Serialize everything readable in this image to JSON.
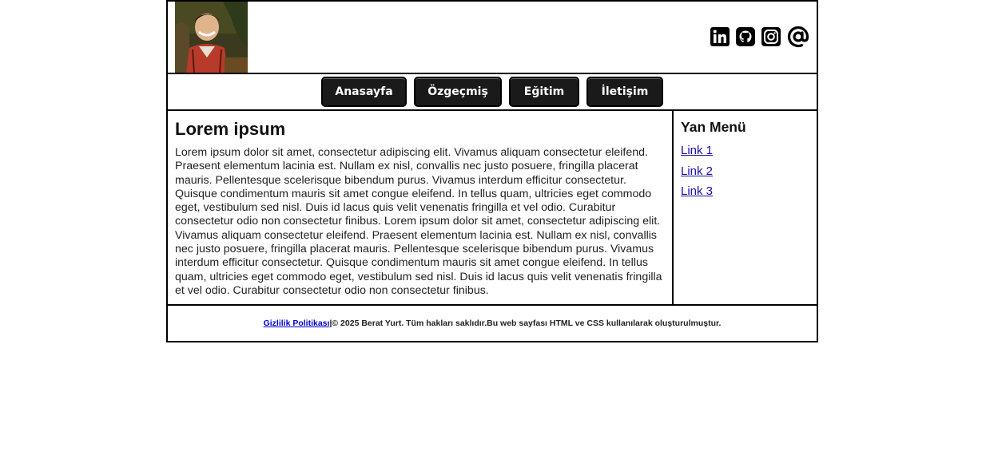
{
  "header": {
    "avatar_alt": "profile photo",
    "social": [
      {
        "name": "linkedin-icon"
      },
      {
        "name": "github-icon"
      },
      {
        "name": "instagram-icon"
      },
      {
        "name": "email-icon"
      }
    ]
  },
  "nav": {
    "items": [
      "Anasayfa",
      "Özgeçmiş",
      "Eğitim",
      "İletişim"
    ]
  },
  "main": {
    "title": "Lorem ipsum",
    "body": "Lorem ipsum dolor sit amet, consectetur adipiscing elit. Vivamus aliquam consectetur eleifend. Praesent elementum lacinia est. Nullam ex nisl, convallis nec justo posuere, fringilla placerat mauris. Pellentesque scelerisque bibendum purus. Vivamus interdum efficitur consectetur. Quisque condimentum mauris sit amet congue eleifend. In tellus quam, ultricies eget commodo eget, vestibulum sed nisl. Duis id lacus quis velit venenatis fringilla et vel odio. Curabitur consectetur odio non consectetur finibus. Lorem ipsum dolor sit amet, consectetur adipiscing elit. Vivamus aliquam consectetur eleifend. Praesent elementum lacinia est. Nullam ex nisl, convallis nec justo posuere, fringilla placerat mauris. Pellentesque scelerisque bibendum purus. Vivamus interdum efficitur consectetur. Quisque condimentum mauris sit amet congue eleifend. In tellus quam, ultricies eget commodo eget, vestibulum sed nisl. Duis id lacus quis velit venenatis fringilla et vel odio. Curabitur consectetur odio non consectetur finibus."
  },
  "sidebar": {
    "title": "Yan Menü",
    "links": [
      "Link 1",
      "Link 2",
      "Link 3"
    ]
  },
  "footer": {
    "privacy_link": "Gizlilik Politikası",
    "text": "|© 2025 Berat Yurt. Tüm hakları saklıdır.Bu web sayfası HTML ve CSS kullanılarak oluşturulmuştur."
  },
  "colors": {
    "border": "#000000",
    "nav_button_bg": "#1a1a1a",
    "nav_button_text": "#ffffff",
    "link": "#1a0dab"
  }
}
